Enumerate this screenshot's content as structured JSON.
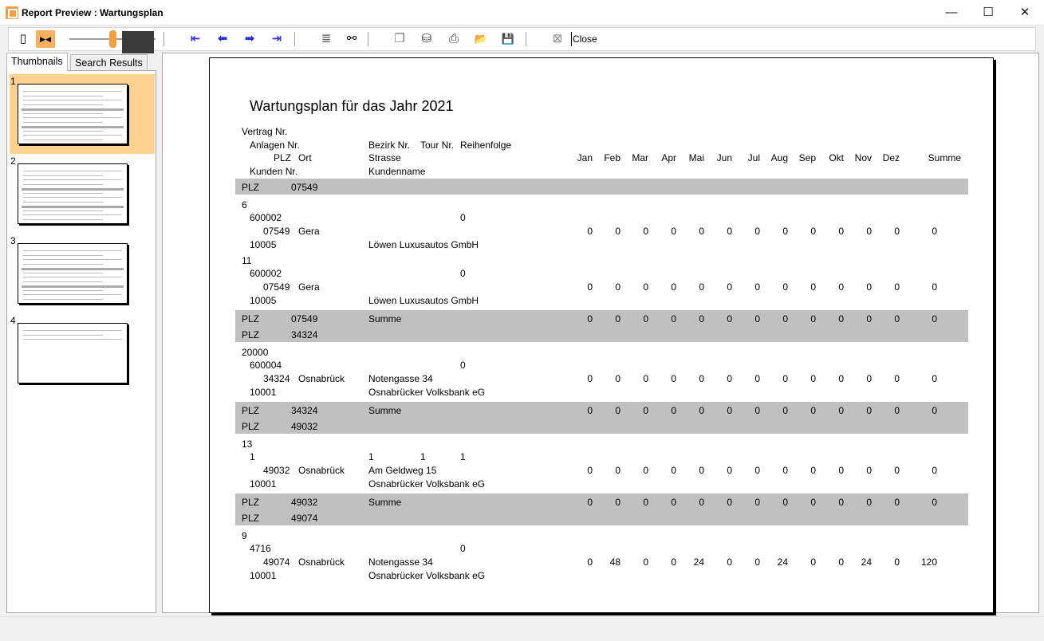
{
  "window": {
    "title": "Report Preview : Wartungsplan",
    "min_glyph": "—",
    "max_glyph": "☐",
    "close_glyph": "✕"
  },
  "toolbar": {
    "single_page_glyph": "▯",
    "multi_page_glyph": "▶◀",
    "first_glyph": "⇤",
    "prev_glyph": "⬅",
    "next_glyph": "➡",
    "last_glyph": "⇥",
    "goto_glyph": "≣",
    "find_glyph": "⚯",
    "copy_glyph": "❐",
    "export_glyph": "⛁",
    "print_glyph": "⎙",
    "open_glyph": "📂",
    "save_glyph": "💾",
    "close_icon_glyph": "⊠",
    "close_label": "Close",
    "zoom_level": 0.55
  },
  "tabs": {
    "thumbnails": "Thumbnails",
    "search_results": "Search Results"
  },
  "thumbnails": [
    {
      "num": "1",
      "selected": true
    },
    {
      "num": "2",
      "selected": false
    },
    {
      "num": "3",
      "selected": false
    },
    {
      "num": "4",
      "selected": false
    }
  ],
  "report": {
    "title": "Wartungsplan für das Jahr 2021",
    "headers": {
      "vertrag": "Vertrag Nr.",
      "anlagen": "Anlagen Nr.",
      "bezirk": "Bezirk Nr.",
      "tour": "Tour Nr.",
      "reihenfolge": "Reihenfolge",
      "plz": "PLZ",
      "ort": "Ort",
      "strasse": "Strasse",
      "kunden": "Kunden Nr.",
      "kundenname": "Kundenname",
      "months": [
        "Jan",
        "Feb",
        "Mar",
        "Apr",
        "Mai",
        "Jun",
        "Jul",
        "Aug",
        "Sep",
        "Okt",
        "Nov",
        "Dez"
      ],
      "summe": "Summe"
    },
    "groups": [
      {
        "plz_label": "PLZ",
        "plz": "07549",
        "records": [
          {
            "vertrag": "6",
            "anlage": "600002",
            "bezirk": "",
            "tour": "",
            "reihenfolge": "0",
            "plz": "07549",
            "ort": "Gera",
            "strasse": "",
            "kunden": "10005",
            "kundenname": "Löwen Luxusautos GmbH",
            "values": [
              "0",
              "0",
              "0",
              "0",
              "0",
              "0",
              "0",
              "0",
              "0",
              "0",
              "0",
              "0"
            ],
            "summe": "0"
          },
          {
            "vertrag": "11",
            "anlage": "600002",
            "bezirk": "",
            "tour": "",
            "reihenfolge": "0",
            "plz": "07549",
            "ort": "Gera",
            "strasse": "",
            "kunden": "10005",
            "kundenname": "Löwen Luxusautos GmbH",
            "values": [
              "0",
              "0",
              "0",
              "0",
              "0",
              "0",
              "0",
              "0",
              "0",
              "0",
              "0",
              "0"
            ],
            "summe": "0"
          }
        ],
        "total_label": "Summe",
        "totals": [
          "0",
          "0",
          "0",
          "0",
          "0",
          "0",
          "0",
          "0",
          "0",
          "0",
          "0",
          "0"
        ],
        "total_summe": "0"
      },
      {
        "plz_label": "PLZ",
        "plz": "34324",
        "records": [
          {
            "vertrag": "20000",
            "anlage": "600004",
            "bezirk": "",
            "tour": "",
            "reihenfolge": "0",
            "plz": "34324",
            "ort": "Osnabrück",
            "strasse": "Notengasse 34",
            "kunden": "10001",
            "kundenname": "Osnabrücker Volksbank eG",
            "values": [
              "0",
              "0",
              "0",
              "0",
              "0",
              "0",
              "0",
              "0",
              "0",
              "0",
              "0",
              "0"
            ],
            "summe": "0"
          }
        ],
        "total_label": "Summe",
        "totals": [
          "0",
          "0",
          "0",
          "0",
          "0",
          "0",
          "0",
          "0",
          "0",
          "0",
          "0",
          "0"
        ],
        "total_summe": "0"
      },
      {
        "plz_label": "PLZ",
        "plz": "49032",
        "records": [
          {
            "vertrag": "13",
            "anlage": "1",
            "bezirk": "1",
            "tour": "1",
            "reihenfolge": "1",
            "plz": "49032",
            "ort": "Osnabrück",
            "strasse": "Am Geldweg 15",
            "kunden": "10001",
            "kundenname": "Osnabrücker Volksbank eG",
            "values": [
              "0",
              "0",
              "0",
              "0",
              "0",
              "0",
              "0",
              "0",
              "0",
              "0",
              "0",
              "0"
            ],
            "summe": "0"
          }
        ],
        "total_label": "Summe",
        "totals": [
          "0",
          "0",
          "0",
          "0",
          "0",
          "0",
          "0",
          "0",
          "0",
          "0",
          "0",
          "0"
        ],
        "total_summe": "0"
      },
      {
        "plz_label": "PLZ",
        "plz": "49074",
        "records": [
          {
            "vertrag": "9",
            "anlage": "4716",
            "bezirk": "",
            "tour": "",
            "reihenfolge": "0",
            "plz": "49074",
            "ort": "Osnabrück",
            "strasse": "Notengasse 34",
            "kunden": "10001",
            "kundenname": "Osnabrücker Volksbank eG",
            "values": [
              "0",
              "48",
              "0",
              "0",
              "24",
              "0",
              "0",
              "24",
              "0",
              "0",
              "24",
              "0"
            ],
            "summe": "120"
          }
        ]
      }
    ]
  }
}
